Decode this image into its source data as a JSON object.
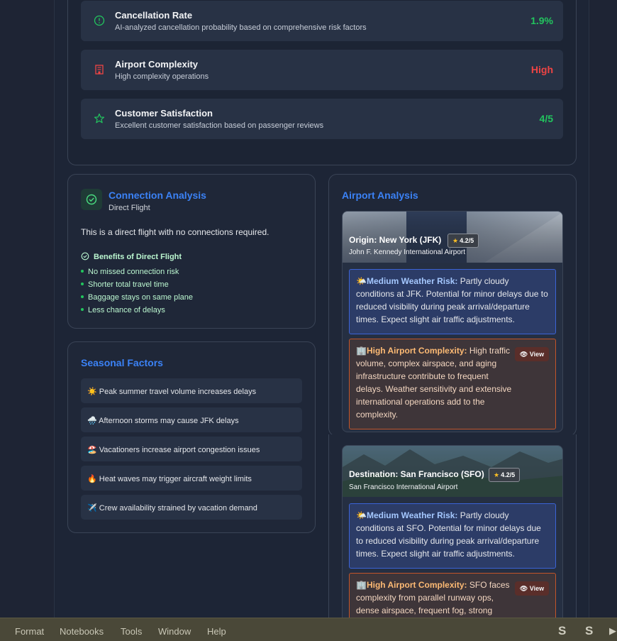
{
  "metrics": [
    {
      "title": "Cancellation Rate",
      "desc": "AI-analyzed cancellation probability based on comprehensive risk factors",
      "value": "1.9%",
      "icon": "alert-circle-icon",
      "color": "#22c55e"
    },
    {
      "title": "Airport Complexity",
      "desc": "High complexity operations",
      "value": "High",
      "icon": "building-icon",
      "color": "#ef4444"
    },
    {
      "title": "Customer Satisfaction",
      "desc": "Excellent customer satisfaction based on passenger reviews",
      "value": "4/5",
      "icon": "star-icon",
      "color": "#22c55e"
    }
  ],
  "connection": {
    "title": "Connection Analysis",
    "subtitle": "Direct Flight",
    "text": "This is a direct flight with no connections required.",
    "benefits_title": "Benefits of Direct Flight",
    "benefits": [
      "No missed connection risk",
      "Shorter total travel time",
      "Baggage stays on same plane",
      "Less chance of delays"
    ]
  },
  "seasonal": {
    "title": "Seasonal Factors",
    "items": [
      "☀️ Peak summer travel volume increases delays",
      "🌧️ Afternoon storms may cause JFK delays",
      "🏖️ Vacationers increase airport congestion issues",
      "🔥 Heat waves may trigger aircraft weight limits",
      "✈️ Crew availability strained by vacation demand"
    ]
  },
  "airport": {
    "title": "Airport Analysis",
    "origin": {
      "title": "Origin: New York (JFK)",
      "rating": "4.2/5",
      "name": "John F. Kennedy International Airport",
      "weather_label": "Medium Weather Risk:",
      "weather_text": "Partly cloudy conditions at JFK. Potential for minor delays due to reduced visibility during peak arrival/departure times. Expect slight air traffic adjustments.",
      "complexity_label": "High Airport Complexity:",
      "complexity_text": "High traffic volume, complex airspace, and aging infrastructure contribute to frequent delays. Weather sensitivity and extensive international operations add to the complexity.",
      "view": "View"
    },
    "destination": {
      "title": "Destination: San Francisco (SFO)",
      "rating": "4.2/5",
      "name": "San Francisco International Airport",
      "weather_label": "Medium Weather Risk:",
      "weather_text": "Partly cloudy conditions at SFO. Potential for minor delays due to reduced visibility during peak arrival/departure times. Expect slight air traffic adjustments.",
      "complexity_label": "High Airport Complexity:",
      "complexity_text": "SFO faces complexity from parallel runway ops, dense airspace, frequent fog, strong",
      "view": "View"
    }
  },
  "menubar": [
    "Format",
    "Notebooks",
    "Tools",
    "Window",
    "Help"
  ]
}
